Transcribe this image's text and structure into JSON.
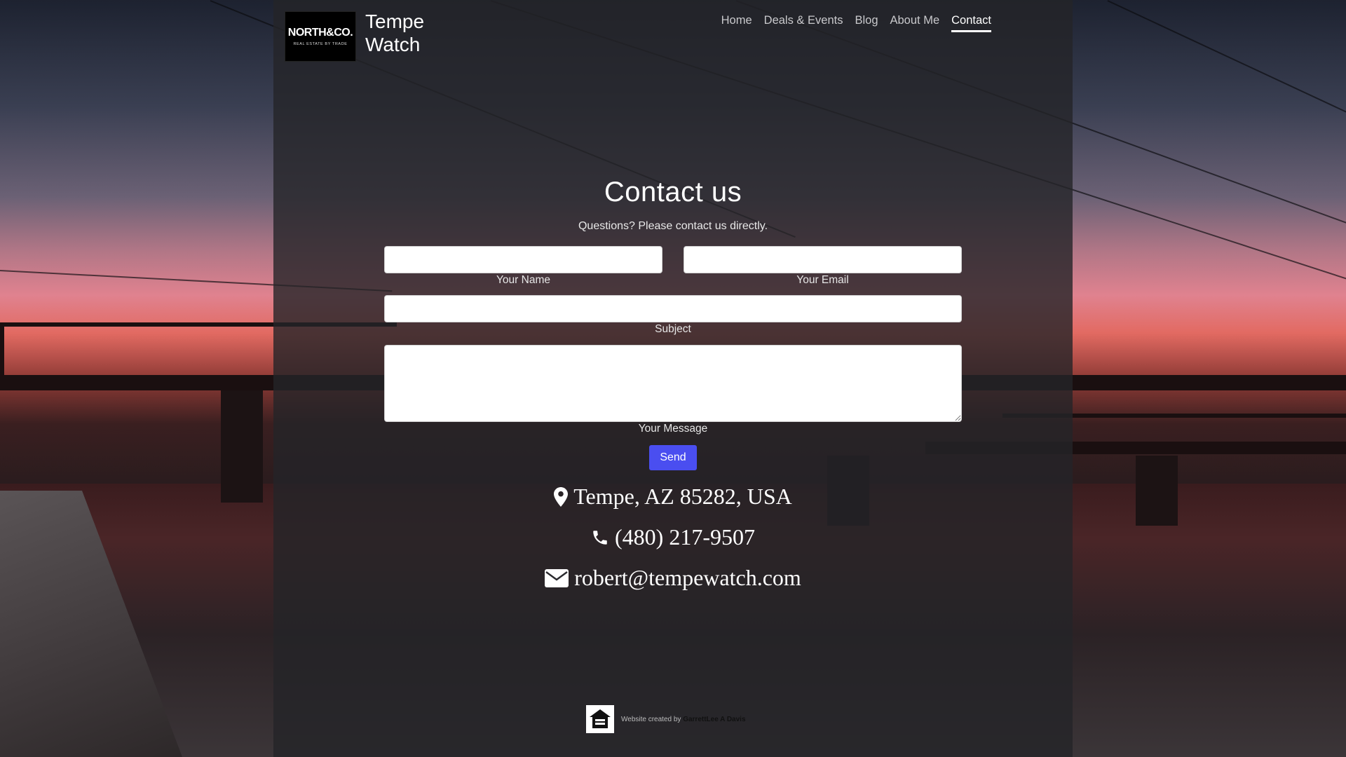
{
  "header": {
    "logo": {
      "main": "NORTH&CO.",
      "tagline": "REAL ESTATE BY TRADE"
    },
    "site_title": "Tempe Watch"
  },
  "nav": {
    "items": [
      {
        "label": "Home",
        "active": false
      },
      {
        "label": "Deals & Events",
        "active": false
      },
      {
        "label": "Blog",
        "active": false
      },
      {
        "label": "About Me",
        "active": false
      },
      {
        "label": "Contact",
        "active": true
      }
    ]
  },
  "contact": {
    "title": "Contact us",
    "subtitle": "Questions? Please contact us directly.",
    "form": {
      "name_label": "Your Name",
      "name_value": "",
      "email_label": "Your Email",
      "email_value": "",
      "subject_label": "Subject",
      "subject_value": "",
      "message_label": "Your Message",
      "message_value": "",
      "send_label": "Send"
    },
    "info": {
      "address": "Tempe, AZ 85282, USA",
      "phone": "(480) 217-9507",
      "email": "robert@tempewatch.com"
    }
  },
  "footer": {
    "created_by_text": "Website created by",
    "author": "GarrettLee A Davis"
  },
  "colors": {
    "overlay": "#242428",
    "send_button": "#4a4ef0",
    "nav_active": "#ffffff",
    "nav_inactive": "#c9c9cc"
  },
  "icons": {
    "address": "map-marker-icon",
    "phone": "phone-icon",
    "email": "envelope-icon",
    "footer": "equal-housing-icon"
  }
}
